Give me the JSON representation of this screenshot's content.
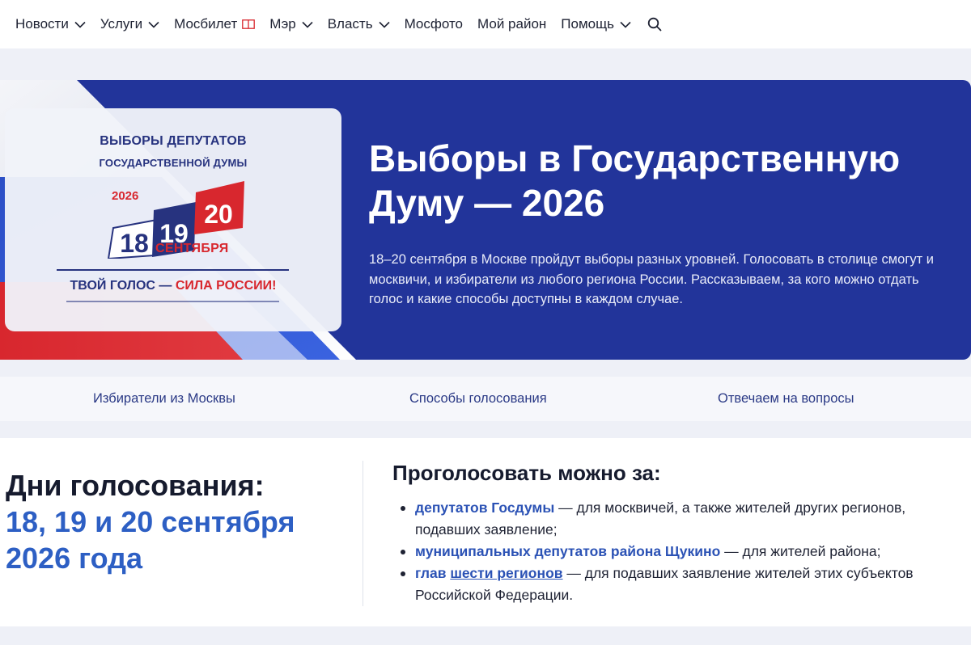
{
  "nav": {
    "items": [
      {
        "label": "Новости",
        "dropdown": true
      },
      {
        "label": "Услуги",
        "dropdown": true
      },
      {
        "label": "Мосбилет",
        "icon": "book-icon"
      },
      {
        "label": "Мэр",
        "dropdown": true
      },
      {
        "label": "Власть",
        "dropdown": true
      },
      {
        "label": "Мосфото"
      },
      {
        "label": "Мой район"
      },
      {
        "label": "Помощь",
        "dropdown": true
      }
    ],
    "search_icon": "search-icon"
  },
  "hero": {
    "poster": {
      "line1": "ВЫБОРЫ ДЕПУТАТОВ",
      "line2": "ГОСУДАРСТВЕННОЙ ДУМЫ",
      "year": "2026",
      "day1": "18",
      "day2": "19",
      "day3": "20",
      "month": "СЕНТЯБРЯ",
      "slogan_part1": "ТВОЙ ГОЛОС — ",
      "slogan_part2": "СИЛА РОССИИ!"
    },
    "title": "Выборы в Государственную Думу — 2026",
    "description": "18–20 сентября в Москве пройдут выборы разных уровней. Голосовать в столице смогут и москвичи, и избиратели из любого региона России. Рассказываем, за кого можно отдать голос и какие способы доступны в каждом случае."
  },
  "tabs": [
    "Избиратели из Москвы",
    "Способы голосования",
    "Отвечаем на вопросы"
  ],
  "voting_days": {
    "title": "Дни голосования:",
    "dates": "18, 19 и 20 сентября 2026 года"
  },
  "vote_for": {
    "title": "Проголосовать можно за:",
    "items": [
      {
        "link": "депутатов Госдумы",
        "text": " — для москвичей, а также жителей других регионов, подавших заявление;"
      },
      {
        "link": "муниципальных депутатов района Щукино",
        "text": " — для жителей района;"
      },
      {
        "link_prefix": "глав ",
        "link": "шести регионов",
        "text": " — для подавших заявление жителей этих субъектов Российской Федерации."
      }
    ]
  },
  "colors": {
    "hero_bg": "#22349a",
    "link": "#2b52b5",
    "date_blue": "#2d5fc4",
    "poster_red": "#d8272e",
    "poster_blue": "#27337f"
  }
}
